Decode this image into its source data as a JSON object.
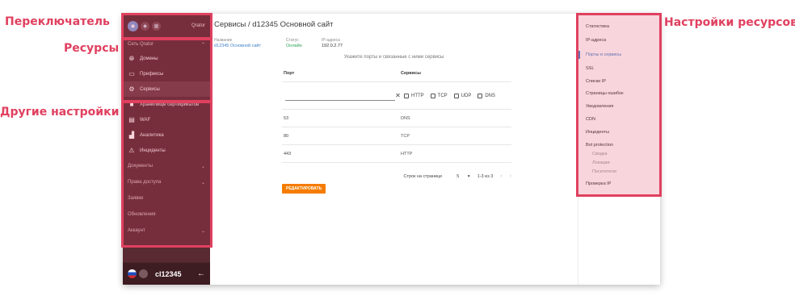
{
  "annotations": {
    "switcher": "Переключатель",
    "resources": "Ресурсы",
    "other_settings": "Другие настройки",
    "resource_settings": "Настройки ресурсов"
  },
  "sidebar": {
    "switcher": [
      "dns-icon",
      "shield-icon",
      "grid-icon"
    ],
    "brand": "Qrator",
    "group_label": "Сеть Qrator",
    "resource_items": [
      {
        "icon": "globe-icon",
        "label": "Домены"
      },
      {
        "icon": "ip-icon",
        "label": "Префиксы"
      },
      {
        "icon": "services-icon",
        "label": "Сервисы"
      }
    ],
    "other_items": [
      {
        "icon": "lock-icon",
        "label": "Хранилище сертификатов"
      },
      {
        "icon": "waf-icon",
        "label": "WAF"
      },
      {
        "icon": "chart-icon",
        "label": "Аналитика"
      },
      {
        "icon": "warning-icon",
        "label": "Инциденты"
      }
    ],
    "sections": [
      {
        "label": "Документы",
        "expandable": true
      },
      {
        "label": "Права доступа",
        "expandable": true
      },
      {
        "label": "Заявки",
        "expandable": false
      },
      {
        "label": "Обновления",
        "expandable": false
      },
      {
        "label": "Аккаунт",
        "expandable": true
      }
    ],
    "bottom": {
      "user": "cl12345",
      "back_icon": "←"
    }
  },
  "main": {
    "title": "Сервисы / d12345 Основной сайт",
    "meta": {
      "name_label": "Название",
      "name_value": "d12345 Основной сайт",
      "status_label": "Статус",
      "status_value": "Онлайн",
      "ip_label": "IP-адреса",
      "ip_value": "192.0.2.77"
    },
    "hint": "Укажите порты и связанные с ними сервисы",
    "table": {
      "col_port": "Порт",
      "col_services": "Сервисы",
      "input_value": "",
      "clear_icon": "✕",
      "checkboxes": [
        "HTTP",
        "TCP",
        "UDP",
        "DNS"
      ],
      "rows": [
        {
          "port": "53",
          "service": "DNS"
        },
        {
          "port": "80",
          "service": "TCP"
        },
        {
          "port": "443",
          "service": "HTTP"
        }
      ]
    },
    "pager": {
      "rows_per_page_label": "Строк на странице",
      "rows_per_page": "5",
      "range": "1-3 из 3"
    },
    "edit_button": "РЕДАКТИРОВАТЬ"
  },
  "right_nav": {
    "items": [
      "Статистика",
      "IP-адреса",
      "Порты и сервисы",
      "SSL",
      "Списки IP",
      "Страницы ошибок",
      "Уведомления",
      "CDN",
      "Инциденты",
      "Bot protection"
    ],
    "selected": "Порты и сервисы",
    "bot_subitems": [
      "Сводка",
      "Локации",
      "Посетители"
    ],
    "last_item": "Проверка IP"
  },
  "colors": {
    "highlight": "#e0405f",
    "sidebar_bg": "#5a2a33",
    "link": "#3f7fc8",
    "status_ok": "#2ea15a",
    "button": "#f57c00"
  }
}
